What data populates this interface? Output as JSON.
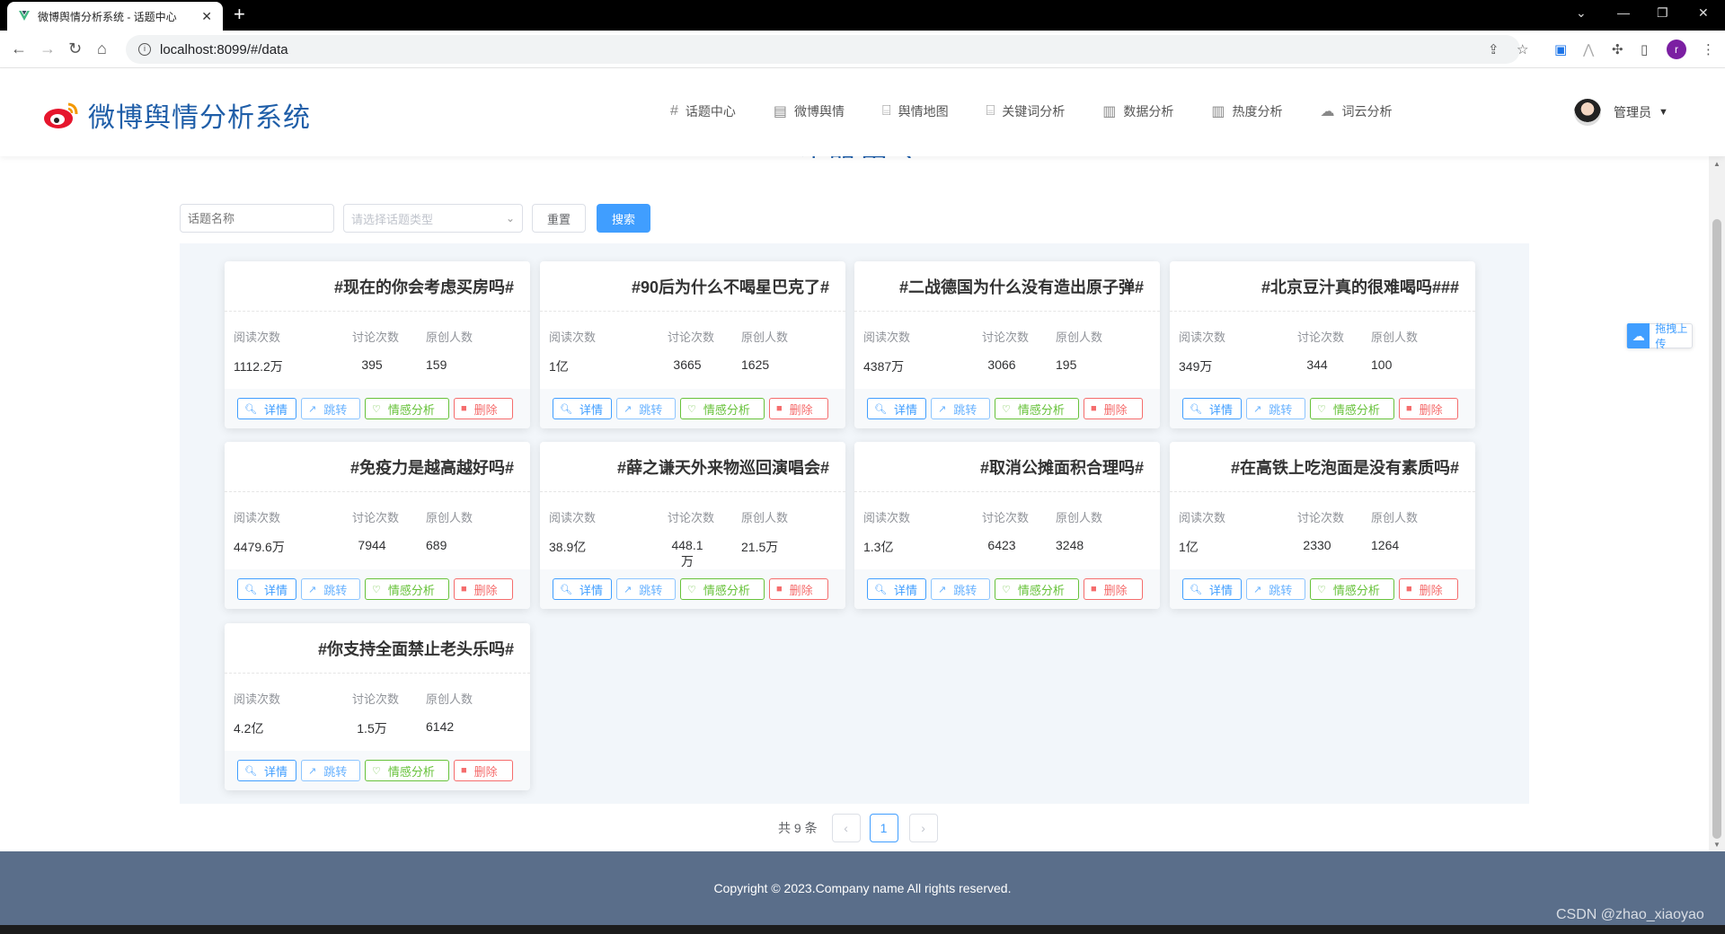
{
  "browser": {
    "tab_title": "微博舆情分析系统 - 话题中心",
    "tab_close": "✕",
    "new_tab": "+",
    "url": "localhost:8099/#/data",
    "profile_initial": "r"
  },
  "app": {
    "title": "微博舆情分析系统",
    "nav": [
      {
        "label": "话题中心",
        "icon": "grid-hash-icon"
      },
      {
        "label": "微博舆情",
        "icon": "document-icon"
      },
      {
        "label": "舆情地图",
        "icon": "building-icon"
      },
      {
        "label": "关键词分析",
        "icon": "building-icon"
      },
      {
        "label": "数据分析",
        "icon": "bar-chart-icon"
      },
      {
        "label": "热度分析",
        "icon": "bar-chart-icon"
      },
      {
        "label": "词云分析",
        "icon": "cloud-icon"
      }
    ],
    "user": {
      "name": "管理员"
    }
  },
  "page": {
    "title": "话题中心"
  },
  "filter": {
    "name_placeholder": "话题名称",
    "type_placeholder": "请选择话题类型",
    "reset_label": "重置",
    "search_label": "搜索"
  },
  "stat_labels": {
    "read": "阅读次数",
    "discuss": "讨论次数",
    "original": "原创人数"
  },
  "actions": {
    "detail": "详情",
    "jump": "跳转",
    "emotion": "情感分析",
    "delete": "删除"
  },
  "topics": [
    {
      "title": "#现在的你会考虑买房吗#",
      "read": "1112.2万",
      "discuss": "395",
      "original": "159"
    },
    {
      "title": "#90后为什么不喝星巴克了#",
      "read": "1亿",
      "discuss": "3665",
      "original": "1625"
    },
    {
      "title": "#二战德国为什么没有造出原子弹#",
      "read": "4387万",
      "discuss": "3066",
      "original": "195"
    },
    {
      "title": "#北京豆汁真的很难喝吗###",
      "read": "349万",
      "discuss": "344",
      "original": "100"
    },
    {
      "title": "#免疫力是越高越好吗#",
      "read": "4479.6万",
      "discuss": "7944",
      "original": "689"
    },
    {
      "title": "#薛之谦天外来物巡回演唱会#",
      "read": "38.9亿",
      "discuss": "448.1万",
      "original": "21.5万"
    },
    {
      "title": "#取消公摊面积合理吗#",
      "read": "1.3亿",
      "discuss": "6423",
      "original": "3248"
    },
    {
      "title": "#在高铁上吃泡面是没有素质吗#",
      "read": "1亿",
      "discuss": "2330",
      "original": "1264"
    },
    {
      "title": "#你支持全面禁止老头乐吗#",
      "read": "4.2亿",
      "discuss": "1.5万",
      "original": "6142"
    }
  ],
  "pagination": {
    "total_text": "共 9 条",
    "current_page": "1",
    "prev": "‹",
    "next": "›"
  },
  "upload_float": {
    "label": "拖拽上传"
  },
  "footer": {
    "copyright": "Copyright © 2023.Company name All rights reserved."
  },
  "watermark": "CSDN @zhao_xiaoyao",
  "colors": {
    "brand": "#1f5ea8",
    "primary": "#409eff",
    "success": "#67c23a",
    "danger": "#f56c6c",
    "footer_bg": "#5a6e8a",
    "panel_bg": "#f2f6fa"
  }
}
